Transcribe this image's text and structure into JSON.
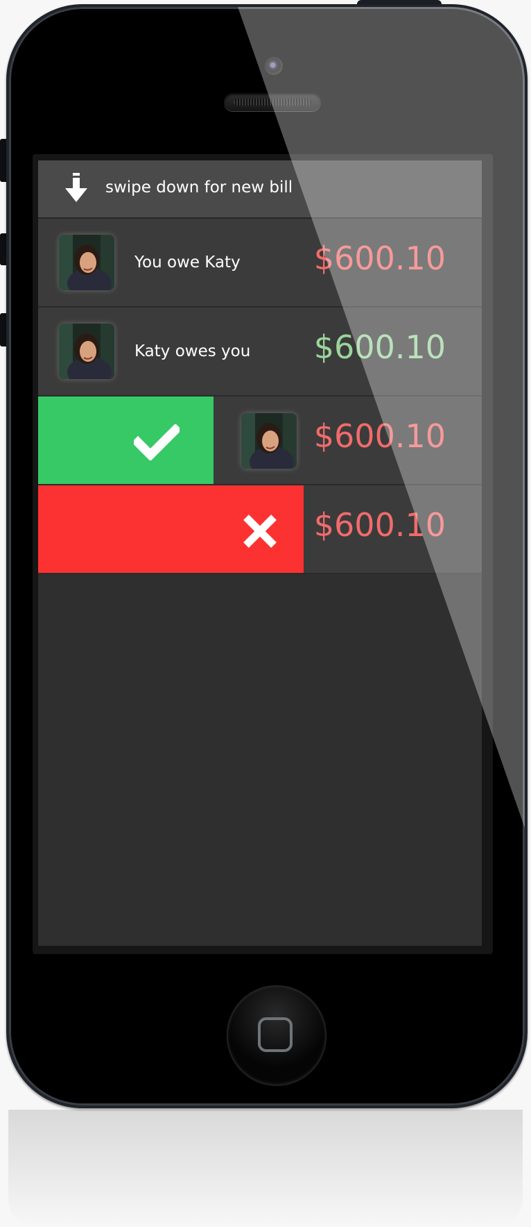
{
  "header": {
    "hint_text": "swipe down for new bill",
    "hint_icon": "arrow-down-icon"
  },
  "bills": [
    {
      "label": "You owe Katy",
      "amount": "$600.10",
      "amount_color": "#f26b6b",
      "state": "normal"
    },
    {
      "label": "Katy owes you",
      "amount": "$600.10",
      "amount_color": "#9bd49b",
      "state": "normal"
    },
    {
      "label": "",
      "amount": "$600.10",
      "amount_color": "#f26b6b",
      "state": "swiped-right-accept",
      "action_icon": "checkmark-icon",
      "action_color": "#37c966"
    },
    {
      "label": "",
      "amount": "$600.10",
      "amount_color": "#f26b6b",
      "state": "swiped-right-reject",
      "action_icon": "close-icon",
      "action_color": "#fc3232"
    }
  ],
  "colors": {
    "screen_background": "#2f2f2f",
    "row_background": "#3b3b3b",
    "header_background": "#4a4a4a",
    "accept": "#37c966",
    "reject": "#fc3232"
  }
}
